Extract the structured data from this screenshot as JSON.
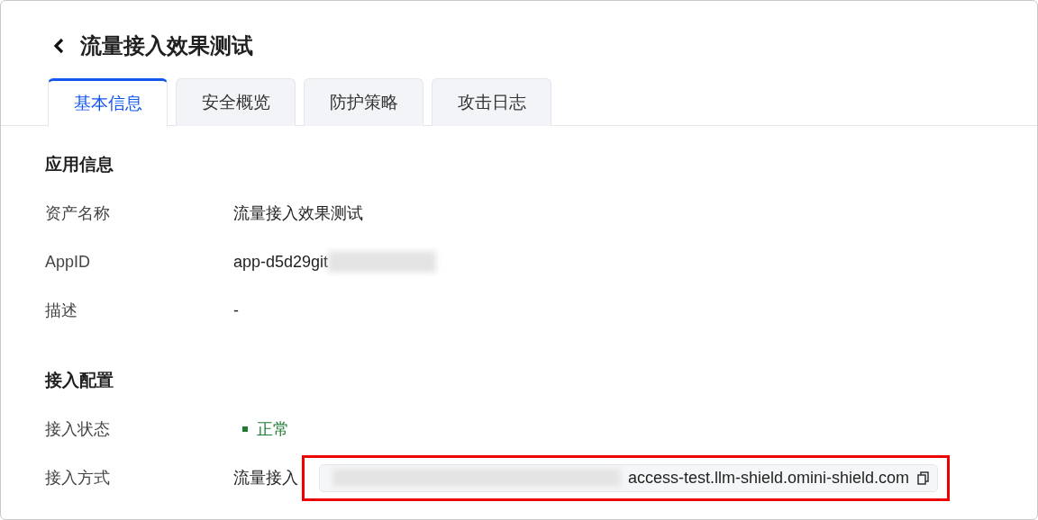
{
  "header": {
    "back_icon": true,
    "title": "流量接入效果测试"
  },
  "tabs": [
    {
      "label": "基本信息",
      "selected": true
    },
    {
      "label": "安全概览",
      "selected": false
    },
    {
      "label": "防护策略",
      "selected": false
    },
    {
      "label": "攻击日志",
      "selected": false
    }
  ],
  "sections": [
    {
      "title": "应用信息",
      "rows": [
        {
          "label": "资产名称",
          "kind": "text",
          "value": "流量接入效果测试"
        },
        {
          "label": "AppID",
          "kind": "redacted",
          "value": "app-d5d29git"
        },
        {
          "label": "描述",
          "kind": "text",
          "value": "-"
        }
      ]
    },
    {
      "title": "接入配置",
      "rows": [
        {
          "label": "接入状态",
          "kind": "status",
          "value": "正常",
          "color": "#1e7b34"
        },
        {
          "label": "接入方式",
          "kind": "address",
          "value": "流量接入",
          "address": "access-test.llm-shield.omini-shield.com",
          "highlighted": true
        }
      ]
    }
  ]
}
